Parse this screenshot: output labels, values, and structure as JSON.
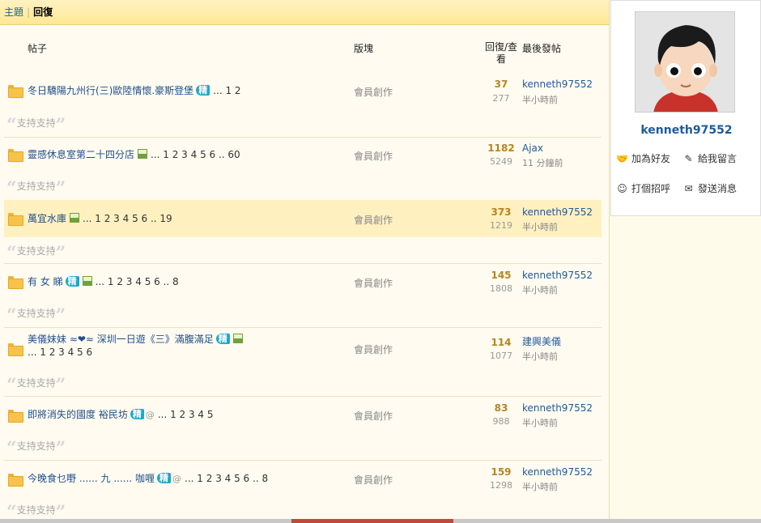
{
  "tabs": {
    "topic": "主題",
    "reply": "回復"
  },
  "headers": {
    "post": "帖子",
    "forum": "版塊",
    "reply_view": "回復/查看",
    "last_post": "最後發帖"
  },
  "quote_text": "支持支持",
  "quote_open": "“",
  "quote_close": "”",
  "posts": [
    {
      "title": "冬日驕陽九州行(三)歐陸情懷.豪斯登堡",
      "badge": "精",
      "pages": "... 1 2",
      "forum": "會員創作",
      "replies": "37",
      "views": "277",
      "last_user": "kenneth97552",
      "last_time": "半小時前"
    },
    {
      "title": "靈感休息室第二十四分店",
      "pages": "... 1 2 3 4 5 6 .. 60",
      "forum": "會員創作",
      "replies": "1182",
      "views": "5249",
      "last_user": "Ajax",
      "last_time": "11 分鐘前"
    },
    {
      "title": "萬宜水庫",
      "pages": "... 1 2 3 4 5 6 .. 19",
      "forum": "會員創作",
      "replies": "373",
      "views": "1219",
      "last_user": "kenneth97552",
      "last_time": "半小時前"
    },
    {
      "title": "有 女 睇",
      "badge": "精",
      "pages": "... 1 2 3 4 5 6 .. 8",
      "forum": "會員創作",
      "replies": "145",
      "views": "1808",
      "last_user": "kenneth97552",
      "last_time": "半小時前"
    },
    {
      "title": "美儀妹妹 ≈❤≈ 深圳一日遊《三》滿腹滿足",
      "badge": "精",
      "pages": "... 1 2 3 4 5 6",
      "forum": "會員創作",
      "replies": "114",
      "views": "1077",
      "last_user": "建興美儀",
      "last_time": "半小時前"
    },
    {
      "title": "即將消失的國度 裕民坊",
      "badge": "精",
      "pages": "... 1 2 3 4 5",
      "forum": "會員創作",
      "replies": "83",
      "views": "988",
      "last_user": "kenneth97552",
      "last_time": "半小時前"
    },
    {
      "title": "今晚食乜嘢 ...... 九 ...... 咖喱",
      "badge": "精",
      "pages": "... 1 2 3 4 5 6 .. 8",
      "forum": "會員創作",
      "replies": "159",
      "views": "1298",
      "last_user": "kenneth97552",
      "last_time": "半小時前"
    }
  ],
  "profile": {
    "username": "kenneth97552",
    "add_friend": "加為好友",
    "leave_message": "給我留言",
    "greet": "打個招呼",
    "send_message": "發送消息"
  },
  "colors": {
    "accent": "#1e5a9c",
    "badge": "#1aa9c9",
    "reply_count": "#b4861f",
    "highlight_row": "#fff0c0"
  }
}
